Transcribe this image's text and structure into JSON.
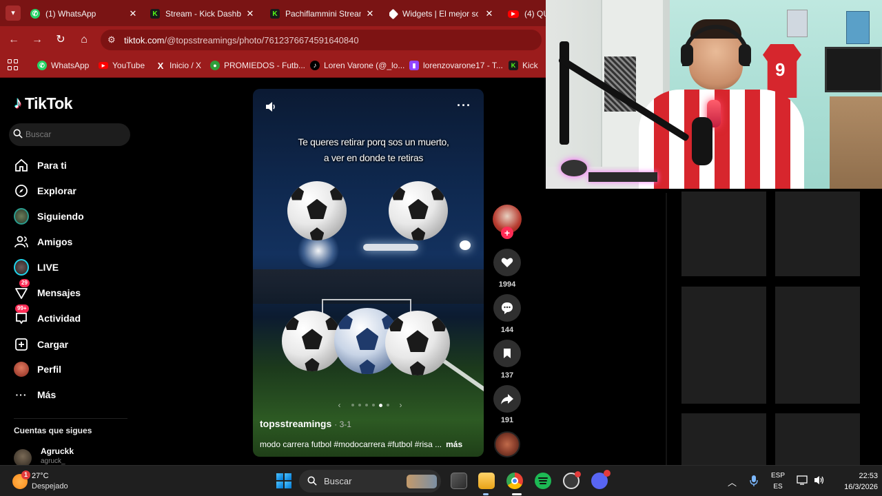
{
  "browser": {
    "tabs": [
      {
        "title": "(1) WhatsApp",
        "icon": "whatsapp-icon",
        "color": "#25d366"
      },
      {
        "title": "Stream - Kick Dashbo",
        "icon": "kick-icon",
        "color": "#53fc18"
      },
      {
        "title": "Pachiflammini Stream",
        "icon": "kick-icon",
        "color": "#53fc18"
      },
      {
        "title": "Widgets | El mejor so",
        "icon": "widgets-icon",
        "color": "#ffffff"
      },
      {
        "title": "(4) QU",
        "icon": "youtube-icon",
        "color": "#ff0000"
      }
    ],
    "url_host": "tiktok.com",
    "url_path": "/@topsstreamings/photo/7612376674591640840",
    "bookmarks": [
      {
        "label": "WhatsApp",
        "icon": "whatsapp-icon",
        "color": "#25d366"
      },
      {
        "label": "YouTube",
        "icon": "youtube-icon",
        "color": "#ff0000"
      },
      {
        "label": "Inicio / X",
        "icon": "x-icon",
        "color": "#000000"
      },
      {
        "label": "PROMIEDOS - Futb...",
        "icon": "promiedos-icon",
        "color": "#2e9e3a"
      },
      {
        "label": "Loren Varone (@_lo...",
        "icon": "tiktok-icon",
        "color": "#000000"
      },
      {
        "label": "lorenzovarone17 - T...",
        "icon": "twitch-icon",
        "color": "#9146ff"
      },
      {
        "label": "Kick",
        "icon": "kick-icon",
        "color": "#53fc18"
      }
    ]
  },
  "tiktok": {
    "brand": "TikTok",
    "search_placeholder": "Buscar",
    "nav": [
      {
        "label": "Para ti",
        "icon": "home-icon"
      },
      {
        "label": "Explorar",
        "icon": "compass-icon"
      },
      {
        "label": "Siguiendo",
        "icon": "following-avatar-icon"
      },
      {
        "label": "Amigos",
        "icon": "friends-icon"
      },
      {
        "label": "LIVE",
        "icon": "live-icon"
      },
      {
        "label": "Mensajes",
        "icon": "messages-icon",
        "badge": "29"
      },
      {
        "label": "Actividad",
        "icon": "activity-icon",
        "badge": "99+"
      },
      {
        "label": "Cargar",
        "icon": "upload-icon"
      },
      {
        "label": "Perfil",
        "icon": "profile-avatar-icon"
      },
      {
        "label": "Más",
        "icon": "more-dots-icon"
      }
    ],
    "following_title": "Cuentas que sigues",
    "following": [
      {
        "name": "Agruckk",
        "handle": "agruck_"
      }
    ],
    "post": {
      "overlay_text": "Te queres retirar porq sos un muerto, a ver en donde te retiras",
      "author": "topsstreamings",
      "date": "· 3-1",
      "caption": "modo carrera futbol #modocarrera #futbol #risa ...",
      "more": "más",
      "likes": "1994",
      "comments": "144",
      "saves": "137",
      "shares": "191",
      "slides": 6,
      "active_slide": 4
    }
  },
  "taskbar": {
    "weather_temp": "27°C",
    "weather_cond": "Despejado",
    "weather_badge": "1",
    "search_placeholder": "Buscar",
    "lang_top": "ESP",
    "lang_bottom": "ES",
    "time": "22:53",
    "date": "16/3/2026"
  }
}
